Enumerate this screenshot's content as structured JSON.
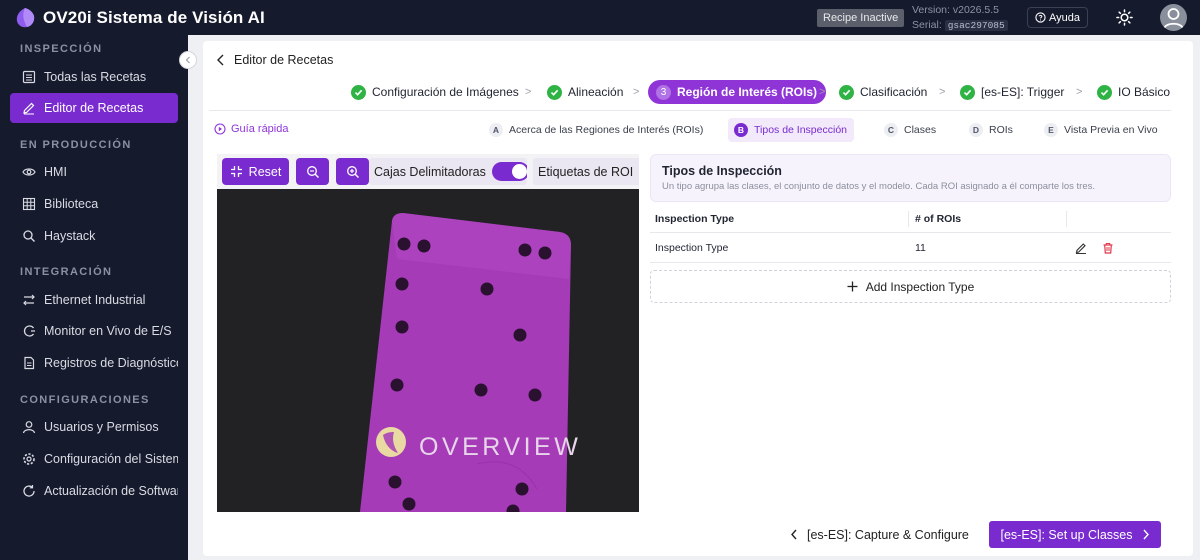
{
  "app": {
    "title": "OV20i Sistema de Visión AI",
    "recipe_status": "Recipe Inactive",
    "version": "Version: v2026.5.5",
    "serial_label": "Serial:",
    "serial_value": "gsac297085",
    "help_label": "Ayuda"
  },
  "sidebar": {
    "sections": [
      {
        "title": "INSPECCIÓN",
        "items": [
          {
            "label": "Todas las Recetas",
            "icon": "list-icon"
          },
          {
            "label": "Editor de Recetas",
            "icon": "edit-icon",
            "active": true
          }
        ]
      },
      {
        "title": "EN PRODUCCIÓN",
        "items": [
          {
            "label": "HMI",
            "icon": "eye-icon"
          },
          {
            "label": "Biblioteca",
            "icon": "grid-icon"
          },
          {
            "label": "Haystack",
            "icon": "search-icon"
          }
        ]
      },
      {
        "title": "INTEGRACIÓN",
        "items": [
          {
            "label": "Ethernet Industrial",
            "icon": "network-icon"
          },
          {
            "label": "Monitor en Vivo de E/S",
            "icon": "monitor-icon"
          },
          {
            "label": "Registros de Diagnóstico",
            "icon": "log-icon"
          }
        ]
      },
      {
        "title": "CONFIGURACIONES",
        "items": [
          {
            "label": "Usuarios y Permisos",
            "icon": "user-icon"
          },
          {
            "label": "Configuración del Sistema",
            "icon": "gear-icon"
          },
          {
            "label": "Actualización de Software",
            "icon": "refresh-icon"
          }
        ]
      }
    ]
  },
  "editor": {
    "back_label": "Editor de Recetas",
    "steps": [
      {
        "label": "Configuración de Imágenes",
        "state": "done"
      },
      {
        "label": "Alineación",
        "state": "done"
      },
      {
        "label": "Región de Interés (ROIs)",
        "state": "active",
        "number": "3"
      },
      {
        "label": "Clasificación",
        "state": "done"
      },
      {
        "label": "[es-ES]: Trigger",
        "state": "done"
      },
      {
        "label": "IO Básico",
        "state": "done"
      }
    ],
    "guide_label": "Guía rápida",
    "substeps": [
      {
        "letter": "A",
        "label": "Acerca de las Regiones de Interés (ROIs)"
      },
      {
        "letter": "B",
        "label": "Tipos de Inspección",
        "active": true
      },
      {
        "letter": "C",
        "label": "Clases"
      },
      {
        "letter": "D",
        "label": "ROIs"
      },
      {
        "letter": "E",
        "label": "Vista Previa en Vivo"
      }
    ]
  },
  "image_toolbar": {
    "reset_label": "Reset",
    "bbox_label": "Cajas Delimitadoras",
    "bbox_on": true,
    "roi_labels_label": "Etiquetas de ROI",
    "roi_labels_on": true
  },
  "viewer": {
    "brand_text": "OVERVIEW",
    "part_color": "#a63bb8"
  },
  "panel": {
    "title": "Tipos de Inspección",
    "subtitle": "Un tipo agrupa las clases, el conjunto de datos y el modelo. Cada ROI asignado a él comparte los tres.",
    "columns": [
      "Inspection Type",
      "# of ROIs"
    ],
    "rows": [
      {
        "name": "Inspection Type",
        "rois": "11"
      }
    ],
    "add_label": "Add Inspection Type"
  },
  "footer": {
    "back_label": "[es-ES]: Capture & Configure",
    "next_label": "[es-ES]: Set up Classes"
  },
  "colors": {
    "accent": "#7a2bd0",
    "success": "#2fb344",
    "sidebar_bg": "#161a2d",
    "delete": "#e0364a"
  }
}
